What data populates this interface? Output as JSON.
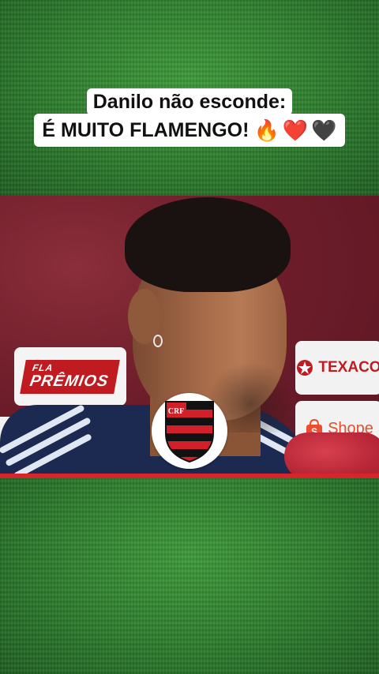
{
  "caption": {
    "line1": "Danilo não esconde:",
    "line2": "É MUITO FLAMENGO!",
    "emojis": [
      "🔥",
      "❤️",
      "🖤"
    ]
  },
  "video": {
    "sponsors": {
      "fla_premios": "PRÊMIOS",
      "fla_premios_top": "FLA",
      "texaco": "TEXACO",
      "shopee": "Shope"
    }
  },
  "badge": {
    "icon": "flamengo-crest-icon",
    "monogram": "CRF"
  },
  "colors": {
    "accent_red": "#c01b20",
    "crest_black": "#111111",
    "turf_green": "#2f7a2f"
  }
}
